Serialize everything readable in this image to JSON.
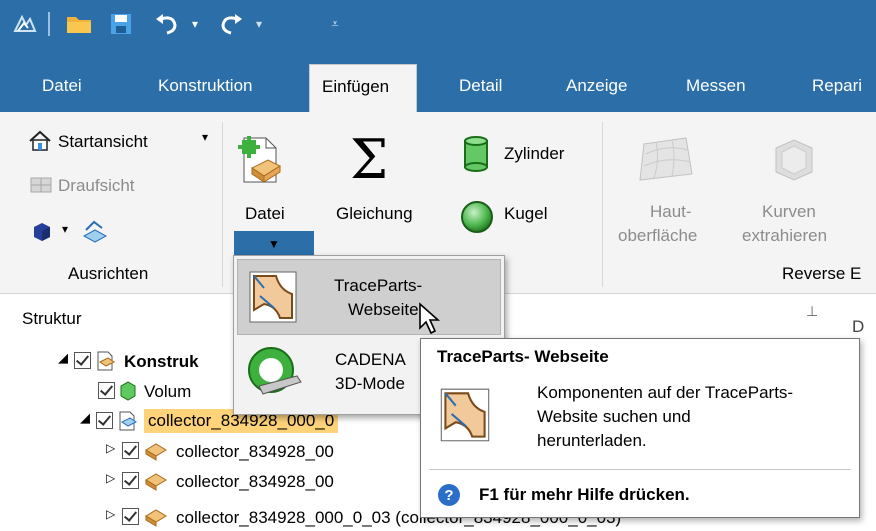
{
  "qat": {
    "app_icon": "app-logo-icon",
    "items": [
      "open-folder-icon",
      "save-icon",
      "undo-icon",
      "redo-icon",
      "customize-qat-icon"
    ]
  },
  "tabs": [
    "Datei",
    "Konstruktion",
    "Einfügen",
    "Detail",
    "Anzeige",
    "Messen",
    "Repari"
  ],
  "active_tab": "Einfügen",
  "ribbon": {
    "ausrichten": {
      "startansicht": "Startansicht",
      "draufsicht": "Draufsicht",
      "group_label": "Ausrichten"
    },
    "datei_label": "Datei",
    "gleichung_label": "Gleichung",
    "zylinder_label": "Zylinder",
    "kugel_label": "Kugel",
    "haut_line1": "Haut-",
    "haut_line2": "oberfläche",
    "kurven_line1": "Kurven",
    "kurven_line2": "extrahieren",
    "reverse_group": "Reverse E"
  },
  "structure": {
    "title": "Struktur",
    "right_letter": "D",
    "rows": [
      {
        "label": "Konstruk"
      },
      {
        "label": "Volum"
      },
      {
        "label": "collector_834928_000_0"
      },
      {
        "label": "collector_834928_00"
      },
      {
        "label": "collector_834928_00"
      },
      {
        "label": "collector_834928_000_0_03 (collector_834928_000_0_03)"
      }
    ]
  },
  "dropdown": {
    "items": [
      {
        "line1": "TraceParts-",
        "line2": "Webseite"
      },
      {
        "line1": "CADENA",
        "line2": "3D-Mode"
      }
    ]
  },
  "tooltip": {
    "title": "TraceParts- Webseite",
    "line1": "Komponenten auf der TraceParts-",
    "line2": "Website suchen und",
    "line3": "herunterladen.",
    "help": "F1 für mehr Hilfe drücken."
  },
  "colors": {
    "titlebar": "#2b6ea8",
    "ribbon_bg": "#f4f4f4",
    "highlight": "#ffd37a",
    "dd_hover": "#cfcfcf"
  }
}
